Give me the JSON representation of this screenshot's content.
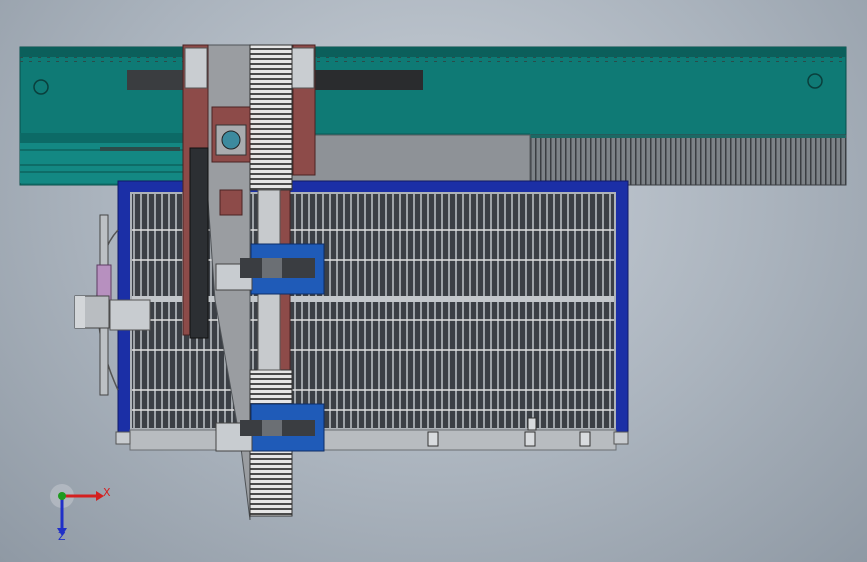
{
  "viewport": {
    "title": "",
    "background": "#aeb6bf"
  },
  "colors": {
    "rail_teal": "#0f7a75",
    "rail_dark": "#0b5753",
    "frame_blue": "#1a2fa8",
    "gantry_grey": "#9a9da1",
    "bracket_red": "#7a3b3b",
    "carriage_blue": "#1f5bb8",
    "slat_dark": "#2e3136",
    "rack_light": "#e1e1e1"
  },
  "triad": {
    "x_label": "X",
    "y_label": "Y",
    "z_label": "Z",
    "x_color": "#d42020",
    "y_color": "#1f9a1f",
    "z_color": "#2030c8"
  }
}
